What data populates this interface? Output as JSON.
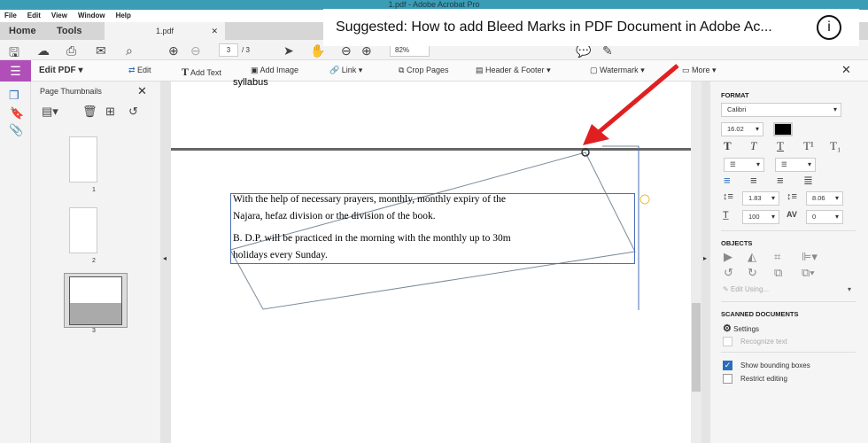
{
  "window": {
    "title": "1.pdf - Adobe Acrobat Pro"
  },
  "menu": [
    "File",
    "Edit",
    "View",
    "Window",
    "Help"
  ],
  "tabs": {
    "home": "Home",
    "tools": "Tools",
    "document": "1.pdf"
  },
  "toolbar": {
    "page_current": "3",
    "page_total": "/ 3",
    "zoom": "82%"
  },
  "suggestion": {
    "text": "Suggested: How to add Bleed Marks in PDF Document in Adobe Ac..."
  },
  "editbar": {
    "title": "Edit PDF",
    "edit": "Edit",
    "add_text": "Add Text",
    "add_image": "Add Image",
    "link": "Link",
    "crop": "Crop Pages",
    "header_footer": "Header & Footer",
    "watermark": "Watermark",
    "more": "More"
  },
  "thumbnails": {
    "title": "Page Thumbnails",
    "pages": [
      "1",
      "2",
      "3"
    ]
  },
  "document": {
    "heading": "syllabus",
    "lines": [
      "With the help of necessary prayers, monthly, monthly expiry of the",
      "Najara, hefaz division or the division of the book.",
      "B. D.P. will be practiced in the morning with the monthly up to 30m",
      "holidays every Sunday."
    ]
  },
  "format": {
    "title": "FORMAT",
    "font": "Calibri",
    "size": "16.02",
    "color": "#000000",
    "line_spacing": "1.83",
    "para_spacing": "8.06",
    "scale": "100",
    "char_spacing": "0"
  },
  "objects": {
    "title": "OBJECTS",
    "edit_using": "Edit Using..."
  },
  "scanned": {
    "title": "SCANNED DOCUMENTS",
    "settings": "Settings",
    "recognize": "Recognize text"
  },
  "options": {
    "show_bounding": "Show bounding boxes",
    "show_bounding_checked": true,
    "restrict": "Restrict editing",
    "restrict_checked": false
  },
  "colors": {
    "accent": "#3b9cb5",
    "edit_purple": "#b04fb8",
    "arrow": "#e02020"
  }
}
